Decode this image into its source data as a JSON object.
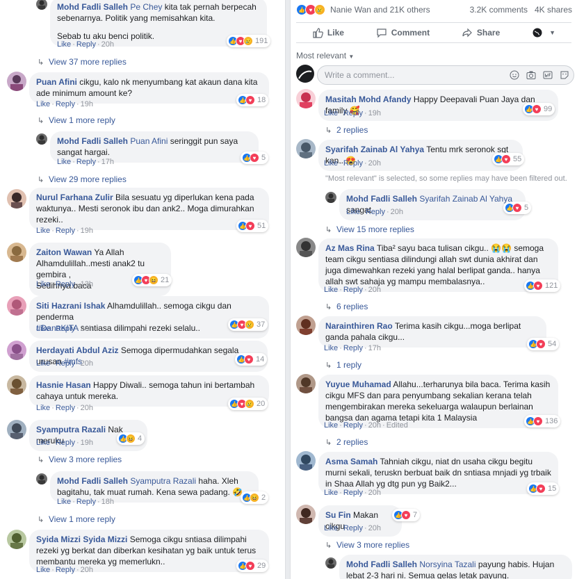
{
  "left": {
    "c1": {
      "name": "Mohd Fadli Salleh",
      "tag": "Pe Chey",
      "text1": "kita tak pernah berpecah sebenarnya. Politik yang memisahkan kita.",
      "text2": "Sebab tu aku benci politik.",
      "like": "Like",
      "reply": "Reply",
      "time": "20h",
      "count": "191"
    },
    "more1": "View 37 more replies",
    "c2": {
      "name": "Puan Afini",
      "text": "cikgu, kalo nk menyumbang kat akaun dana kita ade minimum amount ke?",
      "like": "Like",
      "reply": "Reply",
      "time": "19h",
      "count": "18"
    },
    "more2": "View 1 more reply",
    "c3": {
      "name": "Mohd Fadli Salleh",
      "tag": "Puan Afini",
      "text": "seringgit pun saya sangat hargai.",
      "like": "Like",
      "reply": "Reply",
      "time": "17h",
      "count": "5"
    },
    "more3": "View 29 more replies",
    "c4": {
      "name": "Nurul Farhana Zulir",
      "text": "Bila sesuatu yg diperlukan kena pada waktunya.. Mesti seronok ibu dan ank2.. Moga dimurahkan rezeki..",
      "like": "Like",
      "reply": "Reply",
      "time": "19h",
      "count": "51"
    },
    "c5": {
      "name": "Zaiton Wawan",
      "text1": "Ya Allah",
      "text2": "Alhamdulillah..mesti anak2 tu gembira ,",
      "text3": "Sedihnya baca",
      "like": "Like",
      "reply": "Reply",
      "time": "13h",
      "count": "21"
    },
    "c6": {
      "name": "Siti Hazrani Ishak",
      "text": "Alhamdulillah.. semoga cikgu dan penderma",
      "tag": "#DanaKITA",
      "text2": "sentiasa dilimpahi rezeki selalu..",
      "like": "Like",
      "reply": "Reply",
      "time": "20h",
      "count": "37"
    },
    "c7": {
      "name": "Herdayati Abdul Aziz",
      "text": "Semoga dipermudahkan segala urusan",
      "tag": "#mfs",
      "like": "Like",
      "reply": "Reply",
      "time": "20h",
      "count": "14"
    },
    "c8": {
      "name": "Hasnie Hasan",
      "text": "Happy Diwali.. semoga tahun ini bertambah cahaya untuk mereka.",
      "like": "Like",
      "reply": "Reply",
      "time": "20h",
      "count": "20"
    },
    "c9": {
      "name": "Syamputra Razali",
      "text": "Nak meruku",
      "like": "Like",
      "reply": "Reply",
      "time": "19h",
      "count": "4"
    },
    "more4": "View 3 more replies",
    "c10": {
      "name": "Mohd Fadli Salleh",
      "tag": "Syamputra Razali",
      "text": "haha. Xleh bagitahu, tak muat rumah. Kena sewa padang. 🤣",
      "like": "Like",
      "reply": "Reply",
      "time": "18h",
      "count": "2"
    },
    "more5": "View 1 more reply",
    "c11": {
      "name": "Syida Mizzi Syida Mizzi",
      "text": "Semoga cikgu sntiasa dilimpahi rezeki yg berkat dan diberkan kesihatan yg baik untuk terus membantu mereka yg memerlukn..",
      "like": "Like",
      "reply": "Reply",
      "time": "20h",
      "count": "29"
    }
  },
  "right": {
    "top": {
      "reactors": "Nanie Wan and 21K others",
      "comments": "3.2K comments",
      "shares": "4K shares"
    },
    "actions": {
      "like": "Like",
      "comment": "Comment",
      "share": "Share"
    },
    "sort": "Most relevant",
    "input_placeholder": "Write a comment...",
    "r1": {
      "name": "Masitah Mohd Afandy",
      "text": "Happy Deepavali Puan Jaya dan family 🥰",
      "like": "Like",
      "reply": "Reply",
      "time": "19h",
      "count": "99"
    },
    "rmore1": "2 replies",
    "r2": {
      "name": "Syarifah Zainab Al Yahya",
      "text": "Tentu mrk seronok sgt kan.. 😍",
      "like": "Like",
      "reply": "Reply",
      "time": "20h",
      "count": "55"
    },
    "filter_note": "\"Most relevant\" is selected, so some replies may have been filtered out.",
    "r3": {
      "name": "Mohd Fadli Salleh",
      "tag": "Syarifah Zainab Al Yahya",
      "text": "sangat",
      "like": "Like",
      "reply": "Reply",
      "time": "20h",
      "count": "5"
    },
    "rmore2": "View 15 more replies",
    "r4": {
      "name": "Az Mas Rina",
      "text": "Tiba² sayu baca tulisan cikgu.. 😭😭 semoga team cikgu sentiasa dilindungi allah swt dunia akhirat dan juga dimewahkan rezeki yang halal berlipat ganda.. hanya allah swt sahaja yg mampu membalasnya..",
      "like": "Like",
      "reply": "Reply",
      "time": "20h",
      "count": "121"
    },
    "rmore3": "6 replies",
    "r5": {
      "name": "Narainthiren Rao",
      "text": "Terima kasih cikgu...moga berlipat ganda pahala cikgu...",
      "like": "Like",
      "reply": "Reply",
      "time": "17h",
      "count": "54"
    },
    "rmore4": "1 reply",
    "r6": {
      "name": "Yuyue Muhamad",
      "text": "Allahu...terharunya bila baca. Terima kasih cikgu MFS dan para penyumbang sekalian kerana telah mengembirakan mereka sekeluarga walaupun berlainan bangsa dan agama tetapi kita 1 Malaysia",
      "like": "Like",
      "reply": "Reply",
      "time": "20h",
      "edited": "Edited",
      "count": "136"
    },
    "rmore5": "2 replies",
    "r7": {
      "name": "Asma Samah",
      "text": "Tahniah cikgu, niat dn usaha cikgu begitu murni sekali, teruskn berbuat baik dn sntiasa mnjadi yg trbaik in Shaa Allah yg dtg pun yg Baik2...",
      "like": "Like",
      "reply": "Reply",
      "time": "20h",
      "count": "15"
    },
    "r8": {
      "name": "Su Fin",
      "text": "Makan cikgu",
      "like": "Like",
      "reply": "Reply",
      "time": "20h",
      "count": "7"
    },
    "rmore6": "View 3 more replies",
    "r9": {
      "name": "Mohd Fadli Salleh",
      "tag": "Norsyina Tazali",
      "text": "payung habis. Hujan lebat 2-3 hari ni. Semua gelas letak payung."
    }
  },
  "colors": {
    "link": "#385898",
    "meta": "#90949c",
    "bubble": "#f2f3f5",
    "like_blue": "#1877f2",
    "love_red": "#f33e58",
    "yellow": "#f7b125"
  }
}
